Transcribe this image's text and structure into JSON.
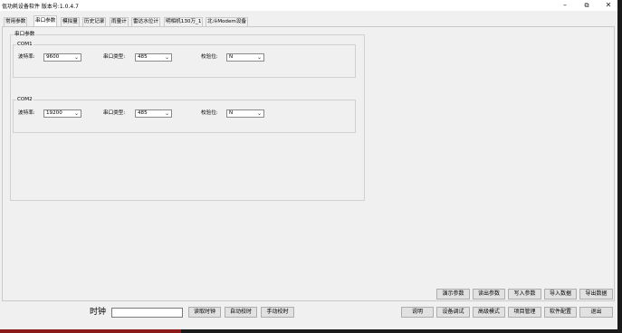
{
  "window": {
    "title": "佤功耗设备软件 版本号:1.0.4.7",
    "controls": {
      "minimize": "–",
      "maximize": "⧉",
      "close": "✕"
    }
  },
  "tabs": [
    {
      "label": "常用参数 ",
      "active": false
    },
    {
      "label": "串口参数",
      "active": true
    },
    {
      "label": "模拟量",
      "active": false
    },
    {
      "label": "历史记录",
      "active": false
    },
    {
      "label": "雨量计",
      "active": false
    },
    {
      "label": "雷达水位计",
      "active": false
    },
    {
      "label": "明相机130万_1",
      "active": false
    },
    {
      "label": "北斗Modem设备",
      "active": false
    }
  ],
  "serial_params": {
    "group_title": "串口参数",
    "com1": {
      "title": "COM1",
      "baud_label": "波特率:",
      "baud_value": "9600",
      "type_label": "串口类型:",
      "type_value": "485",
      "parity_label": "校验位:",
      "parity_value": "N"
    },
    "com2": {
      "title": "COM2",
      "baud_label": "波特率:",
      "baud_value": "19200",
      "type_label": "串口类型:",
      "type_value": "485",
      "parity_label": "校验位:",
      "parity_value": "N"
    }
  },
  "action_row": {
    "demo": "演示参数",
    "read": "读出参数",
    "write": "写入参数",
    "import": "导入数据",
    "export": "导出数据"
  },
  "bottom_bar": {
    "clock_label": "时钟",
    "clock_value": "",
    "read_clock": "读取时钟",
    "auto_sync": "自动校时",
    "manual_sync": "手动校时",
    "help": "说明",
    "debug": "设备调试",
    "advanced": "高级模式",
    "project": "项目管理",
    "config": "软件配置",
    "exit": "退出"
  }
}
